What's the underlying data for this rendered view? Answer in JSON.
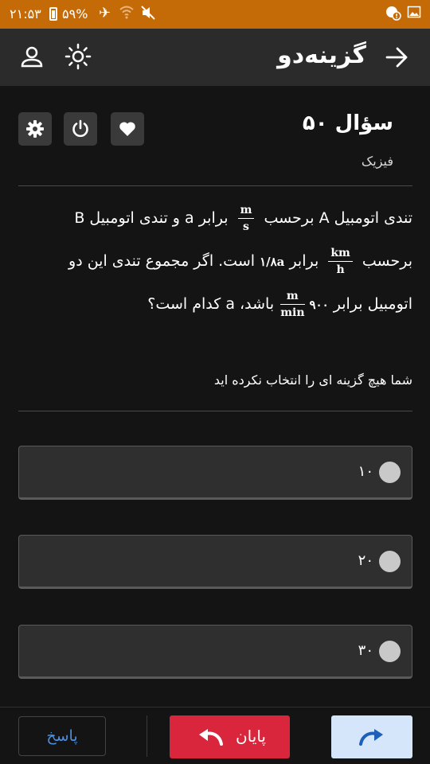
{
  "status_bar": {
    "time": "۲۱:۵۳",
    "battery": "۵۹%",
    "icons": [
      "airplane-icon",
      "wifi-icon",
      "mute-icon",
      "alert-icon",
      "image-icon"
    ]
  },
  "app_bar": {
    "logo": "گزینه‌دو",
    "icons": [
      "forward-arrow-icon",
      "brightness-icon",
      "profile-icon"
    ]
  },
  "question": {
    "title": "سؤال ۵۰",
    "subject": "فیزیک",
    "line1": {
      "part1": "تندی اتومبیل A برحسب",
      "unit_num": "m",
      "unit_den": "s",
      "part2": "برابر a و تندی اتومبیل B"
    },
    "line2": {
      "part1": "برحسب",
      "unit_num": "km",
      "unit_den": "h",
      "part2": "برابر",
      "value": "۱/۸a",
      "part3": "است. اگر مجموع تندی این دو"
    },
    "line3": {
      "part1": "اتومبیل برابر",
      "value": "۹۰۰",
      "unit_num": "m",
      "unit_den": "min",
      "part2": "باشد، a کدام است؟"
    }
  },
  "selection_note": "شما هیچ گزینه ای را انتخاب نکرده اید",
  "options": [
    {
      "label": "۱۰"
    },
    {
      "label": "۲۰"
    },
    {
      "label": "۳۰"
    }
  ],
  "bottom_bar": {
    "answer_label": "پاسخ",
    "end_label": "پایان"
  },
  "colors": {
    "status_bar": "#c46a06",
    "app_bar": "#2b2b2b",
    "background": "#141414",
    "end_button": "#d9263c",
    "next_button": "#d6e6fa",
    "accent_blue": "#4a8fe0"
  }
}
